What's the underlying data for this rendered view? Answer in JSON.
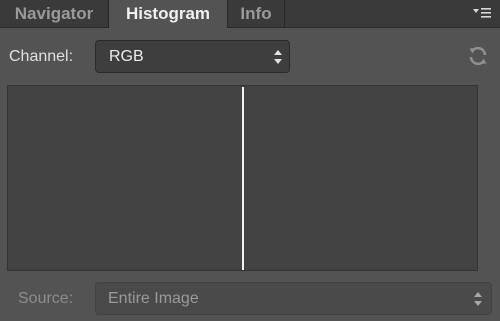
{
  "tabs": [
    {
      "label": "Navigator",
      "active": false
    },
    {
      "label": "Histogram",
      "active": true
    },
    {
      "label": "Info",
      "active": false
    }
  ],
  "panel_menu": {
    "icon": "panel-menu-icon"
  },
  "channel": {
    "label": "Channel:",
    "value": "RGB"
  },
  "refresh": {
    "icon": "refresh-icon"
  },
  "histogram": {
    "line_color": "#f2f2f2",
    "background_color": "#434343"
  },
  "source": {
    "label": "Source:",
    "value": "Entire Image"
  },
  "colors": {
    "panel_bg": "#535353",
    "tabbar_bg": "#3a3a3a",
    "active_tab_text": "#f0f0f0",
    "inactive_tab_text": "#9a9a9a"
  }
}
